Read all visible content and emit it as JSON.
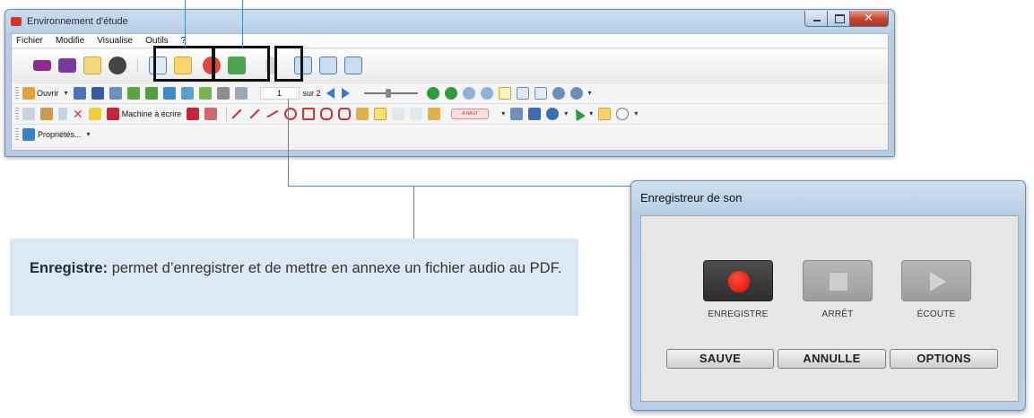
{
  "window": {
    "title": "Environnement d'étude"
  },
  "menubar": {
    "items": [
      "Fichier",
      "Modifie",
      "Visualise",
      "Outils",
      "?"
    ]
  },
  "toolbar2": {
    "open_label": "Ouvrir",
    "page_current": "1",
    "page_total": "sur 2"
  },
  "toolbar3": {
    "typewriter_label": "Machine à écrire"
  },
  "toolbar4": {
    "properties_label": "Propriétés..."
  },
  "callout": {
    "term": "Enregistre:",
    "text": "permet d’enregistrer et de mettre en annexe un fichier audio au PDF."
  },
  "dialog": {
    "title": "Enregistreur de son",
    "record_label": "ENREGISTRE",
    "stop_label": "ARRÊT",
    "play_label": "ÉCOUTE",
    "save_label": "SAUVE",
    "cancel_label": "ANNULLE",
    "options_label": "OPTIONS"
  },
  "colors": {
    "callout_line": "#3d8ec7",
    "callout_bg": "#dce9f4",
    "record_red": "#e00d00",
    "window_frame": "#b7cde6"
  }
}
